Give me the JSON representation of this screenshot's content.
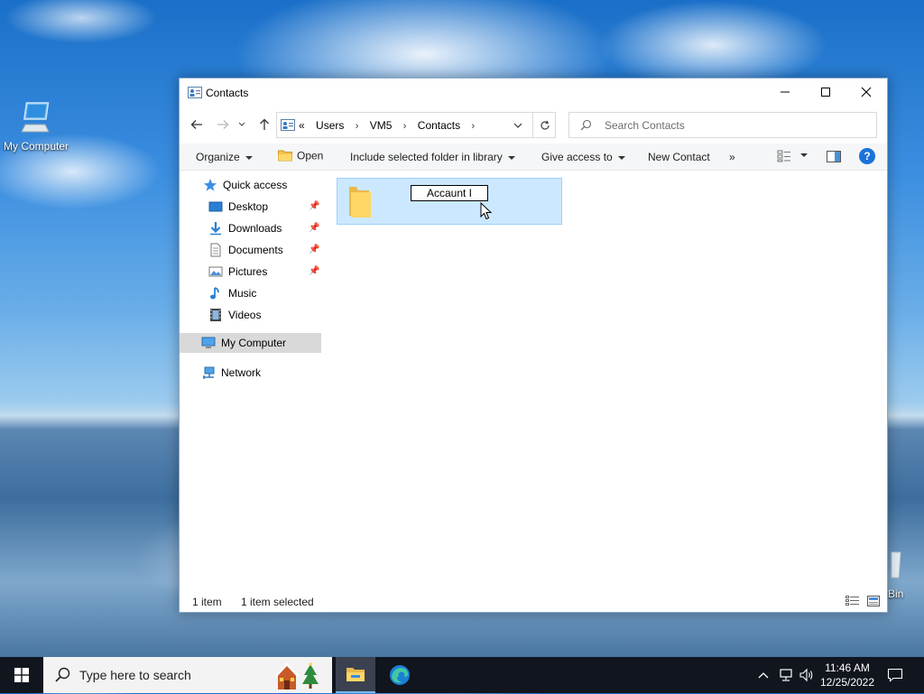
{
  "desktop": {
    "icons": [
      {
        "label": "My Computer"
      },
      {
        "label": "Bin"
      }
    ]
  },
  "window": {
    "title": "Contacts",
    "controls": {
      "minimize": "minimize",
      "maximize": "maximize",
      "close": "close"
    }
  },
  "address": {
    "overflow": "«",
    "crumbs": [
      "Users",
      "VM5",
      "Contacts"
    ]
  },
  "search": {
    "placeholder": "Search Contacts"
  },
  "toolbar": {
    "organize": "Organize",
    "open": "Open",
    "include": "Include selected folder in library",
    "give_access": "Give access to",
    "new_contact": "New Contact",
    "more": "»",
    "help": "?"
  },
  "nav": {
    "quick_access": "Quick access",
    "items": [
      {
        "label": "Desktop",
        "pinned": true
      },
      {
        "label": "Downloads",
        "pinned": true
      },
      {
        "label": "Documents",
        "pinned": true
      },
      {
        "label": "Pictures",
        "pinned": true
      },
      {
        "label": "Music",
        "pinned": false
      },
      {
        "label": "Videos",
        "pinned": false
      }
    ],
    "my_computer": "My Computer",
    "network": "Network"
  },
  "content": {
    "items": [
      {
        "name": "Accaunt I",
        "renaming": true,
        "selected": true
      }
    ]
  },
  "status": {
    "count": "1 item",
    "selected": "1 item selected"
  },
  "taskbar": {
    "search_placeholder": "Type here to search",
    "time": "11:46 AM",
    "date": "12/25/2022"
  },
  "colors": {
    "selection_bg": "#cce8ff",
    "selection_border": "#99d1ff",
    "taskbar": "#11151e",
    "help_blue": "#1a73d9"
  }
}
